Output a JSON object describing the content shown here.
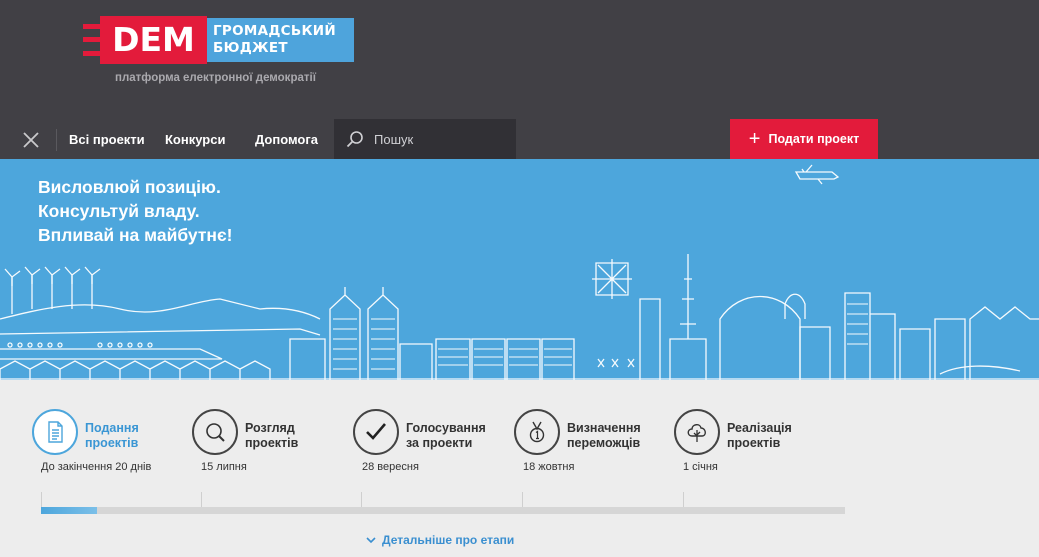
{
  "logo": {
    "mark": "DEM",
    "budget_line1": "ГРОМАДСЬКИЙ",
    "budget_line2": "БЮДЖЕТ",
    "subtitle": "платформа електронної демократії"
  },
  "nav": {
    "items": [
      "Всі проекти",
      "Конкурси",
      "Допомога"
    ],
    "search_placeholder": "Пошук",
    "submit_label": "Подати проект"
  },
  "hero": {
    "line1": "Висловлюй позицію.",
    "line2": "Консультуй владу.",
    "line3": "Впливай на майбутнє!"
  },
  "stages": [
    {
      "title1": "Подання",
      "title2": "проектів",
      "date": "До закінчення 20 днів",
      "icon": "document-icon",
      "active": true
    },
    {
      "title1": "Розгляд",
      "title2": "проектів",
      "date": "15 липня",
      "icon": "magnifier-icon",
      "active": false
    },
    {
      "title1": "Голосування",
      "title2": "за проекти",
      "date": "28 вересня",
      "icon": "checkmark-icon",
      "active": false
    },
    {
      "title1": "Визначення",
      "title2": "переможців",
      "date": "18 жовтня",
      "icon": "medal-icon",
      "active": false
    },
    {
      "title1": "Реалізація",
      "title2": "проектів",
      "date": "1 січня",
      "icon": "tree-icon",
      "active": false
    }
  ],
  "progress": {
    "fraction": 0.07
  },
  "details_label": "Детальніше про етапи",
  "colors": {
    "accent_red": "#e31b3b",
    "accent_blue": "#4da6dc",
    "header_bg": "#414045"
  }
}
